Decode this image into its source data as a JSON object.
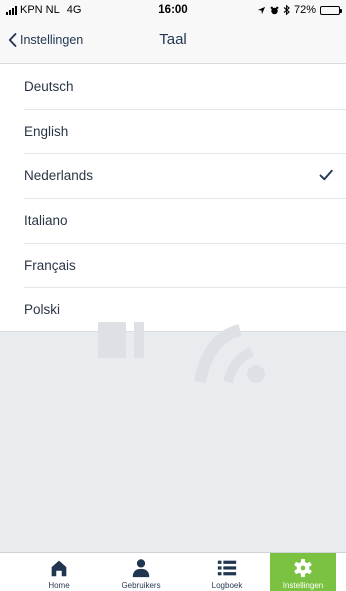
{
  "status_bar": {
    "carrier": "KPN NL",
    "network": "4G",
    "time": "16:00",
    "battery": "72%",
    "battery_level": 0.72
  },
  "nav": {
    "back_label": "Instellingen",
    "title": "Taal"
  },
  "languages": [
    {
      "label": "Deutsch",
      "selected": false
    },
    {
      "label": "English",
      "selected": false
    },
    {
      "label": "Nederlands",
      "selected": true
    },
    {
      "label": "Italiano",
      "selected": false
    },
    {
      "label": "Français",
      "selected": false
    },
    {
      "label": "Polski",
      "selected": false
    }
  ],
  "tabs": [
    {
      "label": "Home",
      "icon": "home-icon",
      "active": false
    },
    {
      "label": "Gebruikers",
      "icon": "user-icon",
      "active": false
    },
    {
      "label": "Logboek",
      "icon": "list-icon",
      "active": false
    },
    {
      "label": "Instellingen",
      "icon": "gear-icon",
      "active": true
    }
  ],
  "colors": {
    "accent": "#7bc142",
    "text": "#1f3550",
    "check": "#1f3550"
  }
}
